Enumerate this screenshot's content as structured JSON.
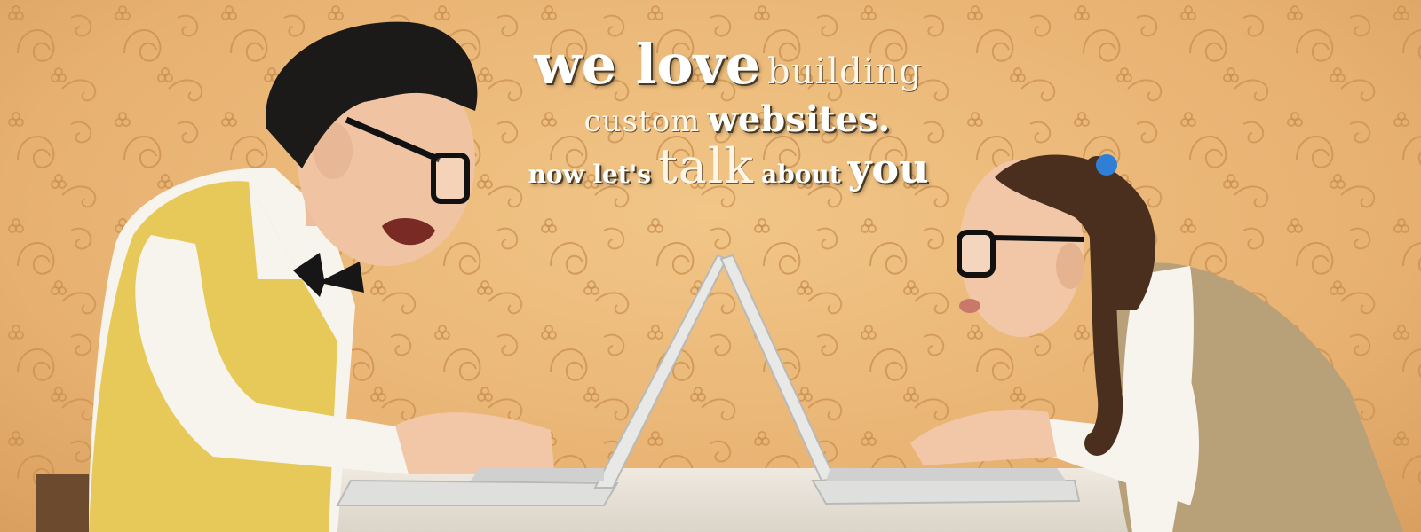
{
  "headline": {
    "line1_bold": "we love",
    "line1_light": "building",
    "line2_light": "custom",
    "line2_bold": "websites.",
    "line3_part1": "now let's",
    "line3_talk": "talk",
    "line3_about": "about",
    "line3_you": "you"
  },
  "colors": {
    "wallpaper": "#e9b774",
    "pattern": "#c98f4e",
    "headline_text": "#ffffff",
    "vest_yellow": "#e7c95a",
    "vest_tan": "#b8a079",
    "shirt": "#f7f4ee",
    "laptop": "#dfe0de"
  }
}
